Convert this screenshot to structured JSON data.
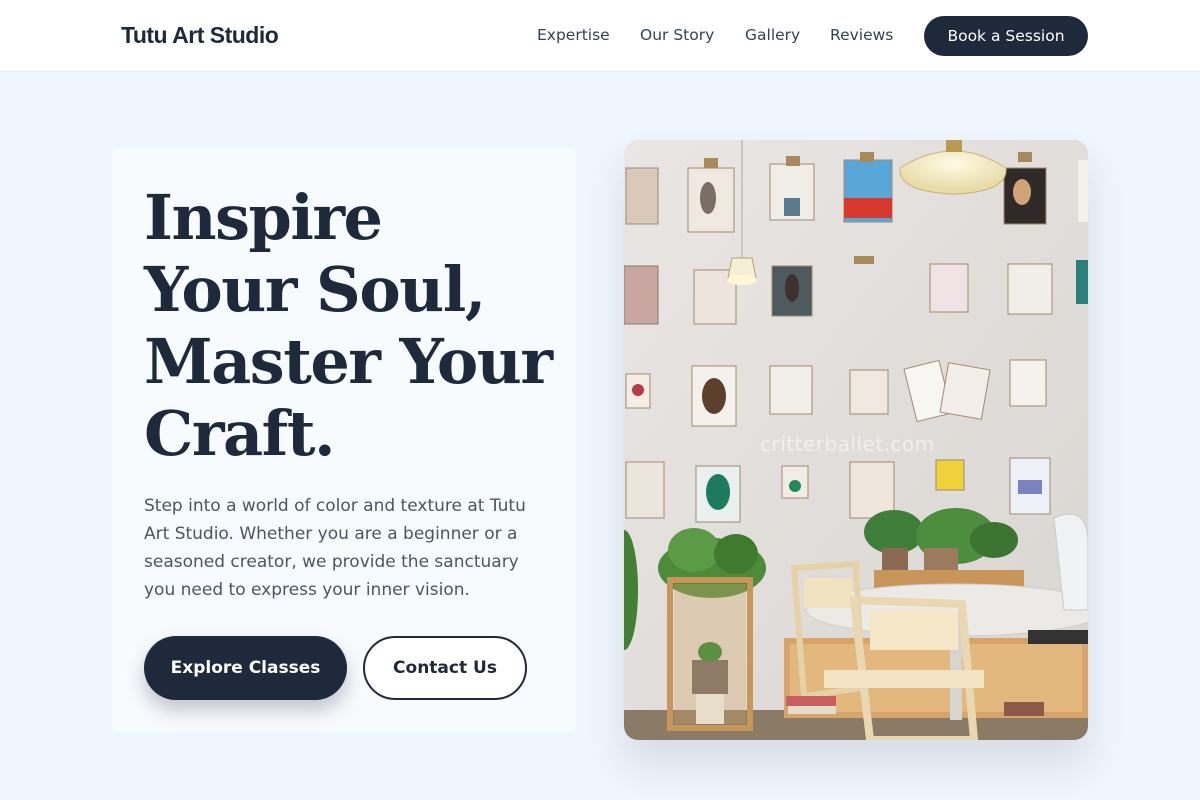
{
  "brand": {
    "name": "Tutu Art Studio"
  },
  "nav": {
    "links": [
      "Expertise",
      "Our Story",
      "Gallery",
      "Reviews"
    ],
    "cta_label": "Book a Session"
  },
  "hero": {
    "title_lines": [
      "Inspire",
      "Your Soul,",
      "Master Your",
      "Craft."
    ],
    "description": "Step into a world of color and texture at Tutu Art Studio. Whether you are a beginner or a seasoned creator, we provide the sanctuary you need to express your inner vision.",
    "primary_button": "Explore Classes",
    "secondary_button": "Contact Us",
    "image_watermark": "critterballet.com"
  },
  "colors": {
    "navy": "#1e293b",
    "page_background": "#f0f6fd",
    "card_background": "#f8fbfe",
    "body_text": "#4b5563"
  }
}
